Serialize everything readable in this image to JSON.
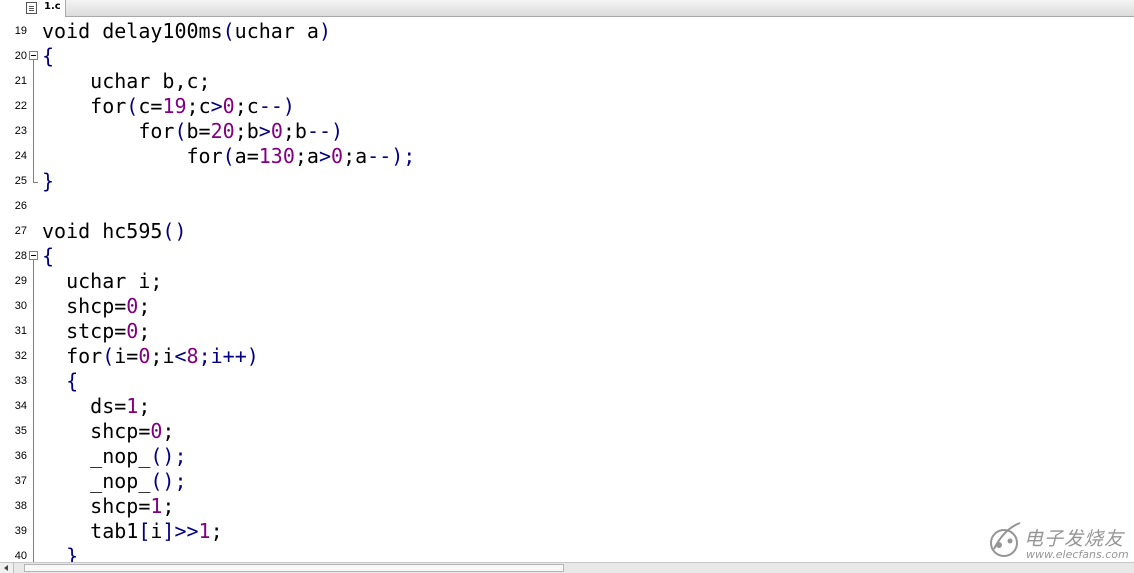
{
  "tab": {
    "label": "1.c",
    "icon": "document-icon"
  },
  "gutter": {
    "line_numbers": [
      "19",
      "20",
      "21",
      "22",
      "23",
      "24",
      "25",
      "26",
      "27",
      "28",
      "29",
      "30",
      "31",
      "32",
      "33",
      "34",
      "35",
      "36",
      "37",
      "38",
      "39",
      "40"
    ]
  },
  "code_lines": [
    [
      [
        "void delay100ms",
        "t"
      ],
      [
        "(",
        "o"
      ],
      [
        "uchar a",
        "t"
      ],
      [
        ")",
        "o"
      ]
    ],
    [
      [
        "{",
        "o"
      ]
    ],
    [
      [
        "    uchar b,c;",
        "t"
      ]
    ],
    [
      [
        "    for",
        "t"
      ],
      [
        "(",
        "o"
      ],
      [
        "c=",
        "t"
      ],
      [
        "19",
        "n"
      ],
      [
        ";c",
        "t"
      ],
      [
        ">",
        "o"
      ],
      [
        "0",
        "n"
      ],
      [
        ";c",
        "t"
      ],
      [
        "--)",
        "o"
      ]
    ],
    [
      [
        "        for",
        "t"
      ],
      [
        "(",
        "o"
      ],
      [
        "b=",
        "t"
      ],
      [
        "20",
        "n"
      ],
      [
        ";b",
        "t"
      ],
      [
        ">",
        "o"
      ],
      [
        "0",
        "n"
      ],
      [
        ";b",
        "t"
      ],
      [
        "--)",
        "o"
      ]
    ],
    [
      [
        "            for",
        "t"
      ],
      [
        "(",
        "o"
      ],
      [
        "a=",
        "t"
      ],
      [
        "130",
        "n"
      ],
      [
        ";a",
        "t"
      ],
      [
        ">",
        "o"
      ],
      [
        "0",
        "n"
      ],
      [
        ";a",
        "t"
      ],
      [
        "--);",
        "o"
      ]
    ],
    [
      [
        "}",
        "o"
      ]
    ],
    [
      [
        "",
        "t"
      ]
    ],
    [
      [
        "void hc595",
        "t"
      ],
      [
        "()",
        "o"
      ]
    ],
    [
      [
        "{",
        "o"
      ]
    ],
    [
      [
        "  uchar i;",
        "t"
      ]
    ],
    [
      [
        "  shcp=",
        "t"
      ],
      [
        "0",
        "n"
      ],
      [
        ";",
        "t"
      ]
    ],
    [
      [
        "  stcp=",
        "t"
      ],
      [
        "0",
        "n"
      ],
      [
        ";",
        "t"
      ]
    ],
    [
      [
        "  for",
        "t"
      ],
      [
        "(",
        "o"
      ],
      [
        "i=",
        "t"
      ],
      [
        "0",
        "n"
      ],
      [
        ";i",
        "t"
      ],
      [
        "<",
        "o"
      ],
      [
        "8",
        "n"
      ],
      [
        ";i++)",
        "o"
      ]
    ],
    [
      [
        "  {",
        "o"
      ]
    ],
    [
      [
        "    ds=",
        "t"
      ],
      [
        "1",
        "n"
      ],
      [
        ";",
        "t"
      ]
    ],
    [
      [
        "    shcp=",
        "t"
      ],
      [
        "0",
        "n"
      ],
      [
        ";",
        "t"
      ]
    ],
    [
      [
        "    _nop_",
        "t"
      ],
      [
        "();",
        "o"
      ]
    ],
    [
      [
        "    _nop_",
        "t"
      ],
      [
        "();",
        "o"
      ]
    ],
    [
      [
        "    shcp=",
        "t"
      ],
      [
        "1",
        "n"
      ],
      [
        ";",
        "t"
      ]
    ],
    [
      [
        "    tab1",
        "t"
      ],
      [
        "[",
        "o"
      ],
      [
        "i",
        "t"
      ],
      [
        "]>>",
        "o"
      ],
      [
        "1",
        "n"
      ],
      [
        ";",
        "t"
      ]
    ],
    [
      [
        "  }",
        "o"
      ]
    ]
  ],
  "watermark": {
    "cn": "电子发烧友",
    "url": "www.elecfans.com"
  },
  "colors": {
    "text": "#000000",
    "number": "#800080",
    "operator": "#000080"
  }
}
